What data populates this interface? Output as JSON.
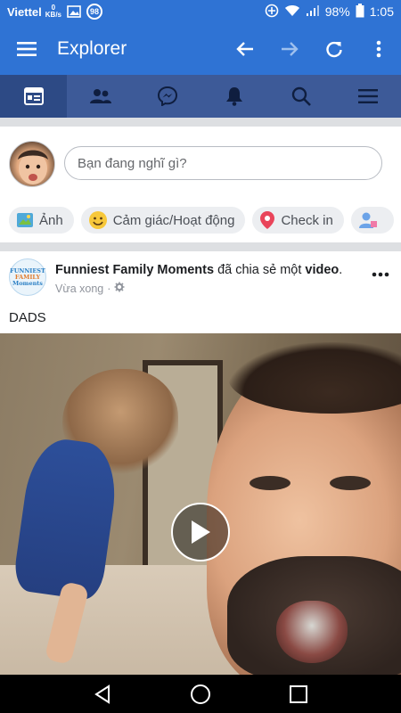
{
  "status_bar": {
    "carrier": "Viettel",
    "data_speed": "0",
    "data_unit": "KB/s",
    "notification_badge": "98",
    "battery_percent": "98%",
    "time": "1:05"
  },
  "app_bar": {
    "title": "Explorer",
    "background_color": "#2f73d4"
  },
  "tabs": [
    {
      "icon": "news-feed-icon",
      "active": true
    },
    {
      "icon": "friends-icon",
      "active": false
    },
    {
      "icon": "messenger-icon",
      "active": false
    },
    {
      "icon": "bell-icon",
      "active": false
    },
    {
      "icon": "search-icon",
      "active": false
    },
    {
      "icon": "menu-icon",
      "active": false
    }
  ],
  "composer": {
    "placeholder": "Bạn đang nghĩ gì?",
    "chips": [
      {
        "label": "Ảnh",
        "icon": "photo-icon"
      },
      {
        "label": "Cảm giác/Hoạt động",
        "icon": "smiley-icon"
      },
      {
        "label": "Check in",
        "icon": "location-pin-icon"
      },
      {
        "label": "",
        "icon": "tag-people-icon"
      }
    ]
  },
  "post": {
    "logo_text": [
      "FUNNIEST",
      "FAMILY",
      "Moments"
    ],
    "page_name": "Funniest Family Moments",
    "action_text": " đã chia sẻ một ",
    "object_text": "video",
    "action_end": ".",
    "time": "Vừa xong",
    "separator": "·",
    "privacy_icon": "public-gear-icon",
    "text": "DADS"
  },
  "colors": {
    "tab_bar": "#3d5a98",
    "tab_active": "#2d4a85",
    "divider": "#dddfe2"
  }
}
